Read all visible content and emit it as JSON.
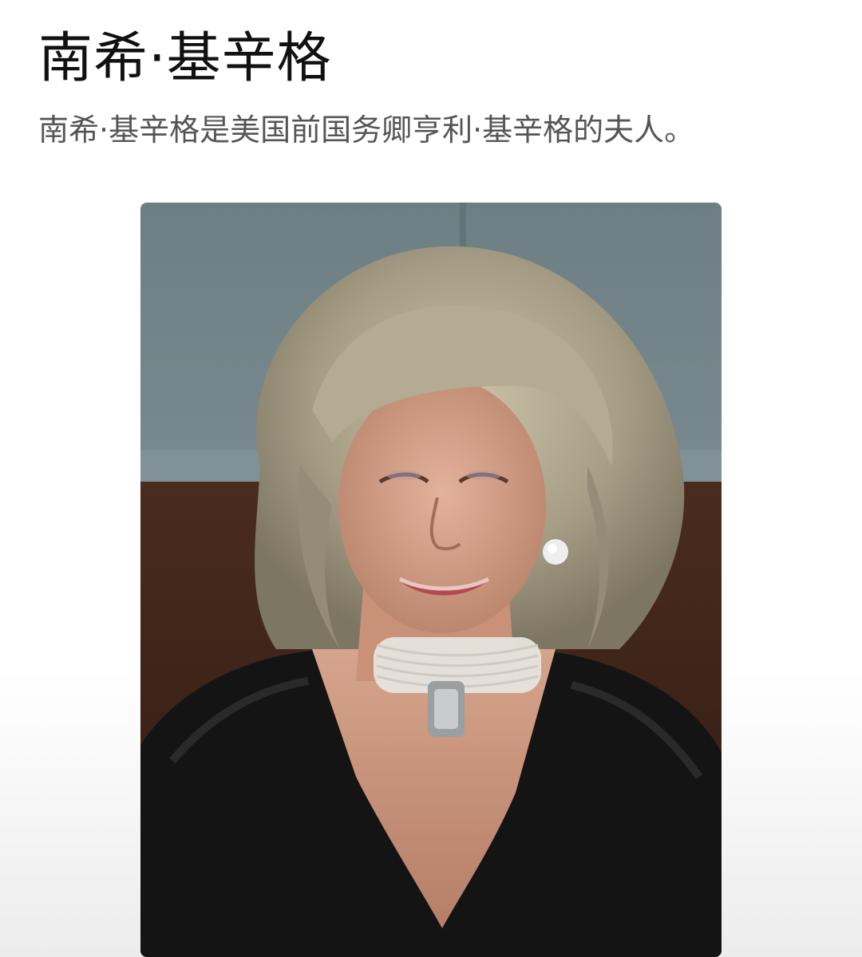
{
  "article": {
    "title": "南希·基辛格",
    "summary": "南希·基辛格是美国前国务卿亨利·基辛格的夫人。"
  },
  "photo": {
    "subject": "portrait-photo"
  }
}
